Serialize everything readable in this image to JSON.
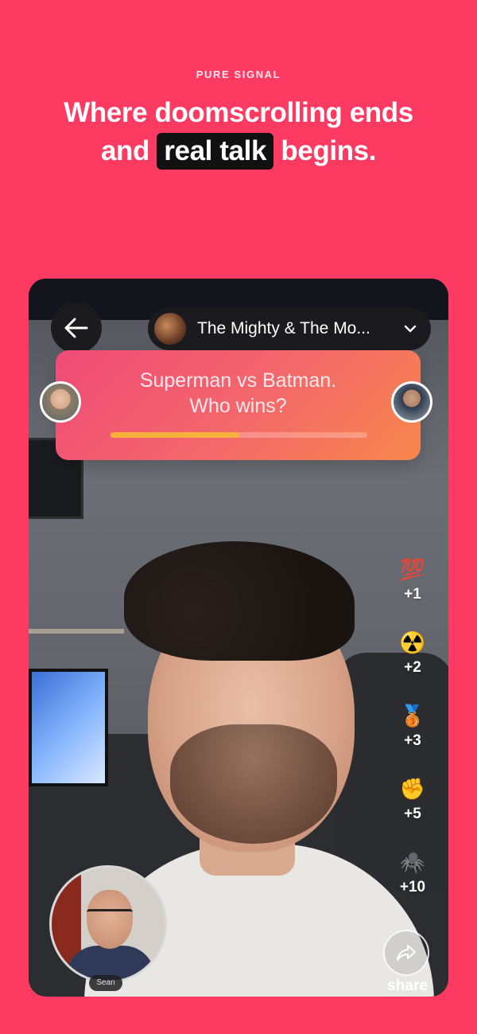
{
  "header": {
    "eyebrow": "PURE SIGNAL",
    "headline_line1": "Where doomscrolling ends",
    "headline_pre": "and",
    "headline_highlight": "real talk",
    "headline_post": "begins."
  },
  "call": {
    "back_icon": "arrow-left-icon",
    "room_title": "The Mighty & The Mo...",
    "room_dropdown_icon": "chevron-down-icon",
    "question_line1": "Superman vs Batman.",
    "question_line2": "Who wins?",
    "question_progress": 0.5,
    "reactions": [
      {
        "emoji": "💯",
        "count": "+1"
      },
      {
        "emoji": "☢️",
        "count": "+2"
      },
      {
        "emoji": "🥉",
        "count": "+3"
      },
      {
        "emoji": "✊",
        "count": "+5"
      },
      {
        "emoji": "🕷️",
        "count": "+10"
      }
    ],
    "share_label": "share",
    "self_name": "Sean"
  },
  "colors": {
    "background": "#fc3a62",
    "highlight_bg": "#111111",
    "progress_fill": "#f6b13a"
  }
}
